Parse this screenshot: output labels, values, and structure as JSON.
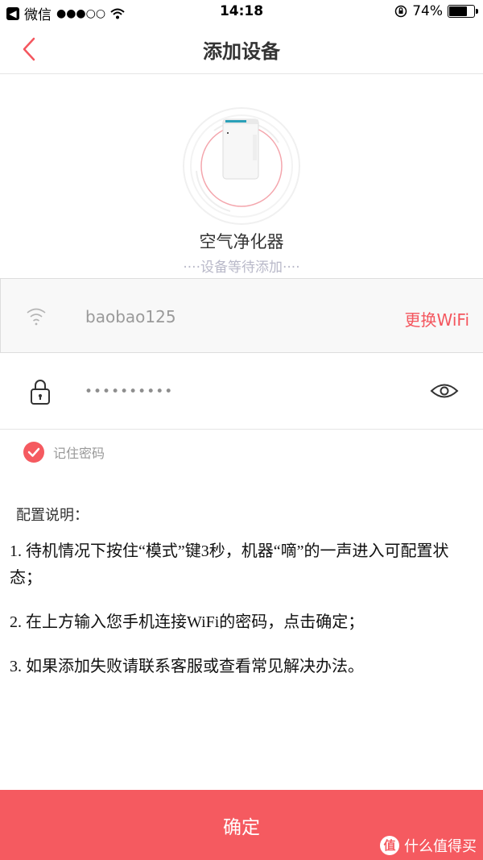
{
  "status_bar": {
    "app": "微信",
    "signal": "●●●○○",
    "time": "14:18",
    "battery": "74%",
    "battery_level": 0.74
  },
  "nav": {
    "title": "添加设备"
  },
  "device": {
    "name": "空气净化器",
    "status": "····设备等待添加····"
  },
  "wifi": {
    "ssid": "baobao125",
    "change_label": "更换WiFi"
  },
  "password": {
    "value": "••••••••••"
  },
  "remember": {
    "label": "记住密码",
    "checked": true
  },
  "instructions": {
    "title": "配置说明：",
    "items": [
      "1. 待机情况下按住“模式”键3秒，机器“嘀”的一声进入可配置状态；",
      "2. 在上方输入您手机连接WiFi的密码，点击确定；",
      "3. 如果添加失败请联系客服或查看常见解决办法。"
    ]
  },
  "confirm_label": "确定",
  "watermark": {
    "logo": "值",
    "text": "什么值得买"
  },
  "colors": {
    "accent": "#f55a60",
    "ring": "#f4a6ad"
  }
}
